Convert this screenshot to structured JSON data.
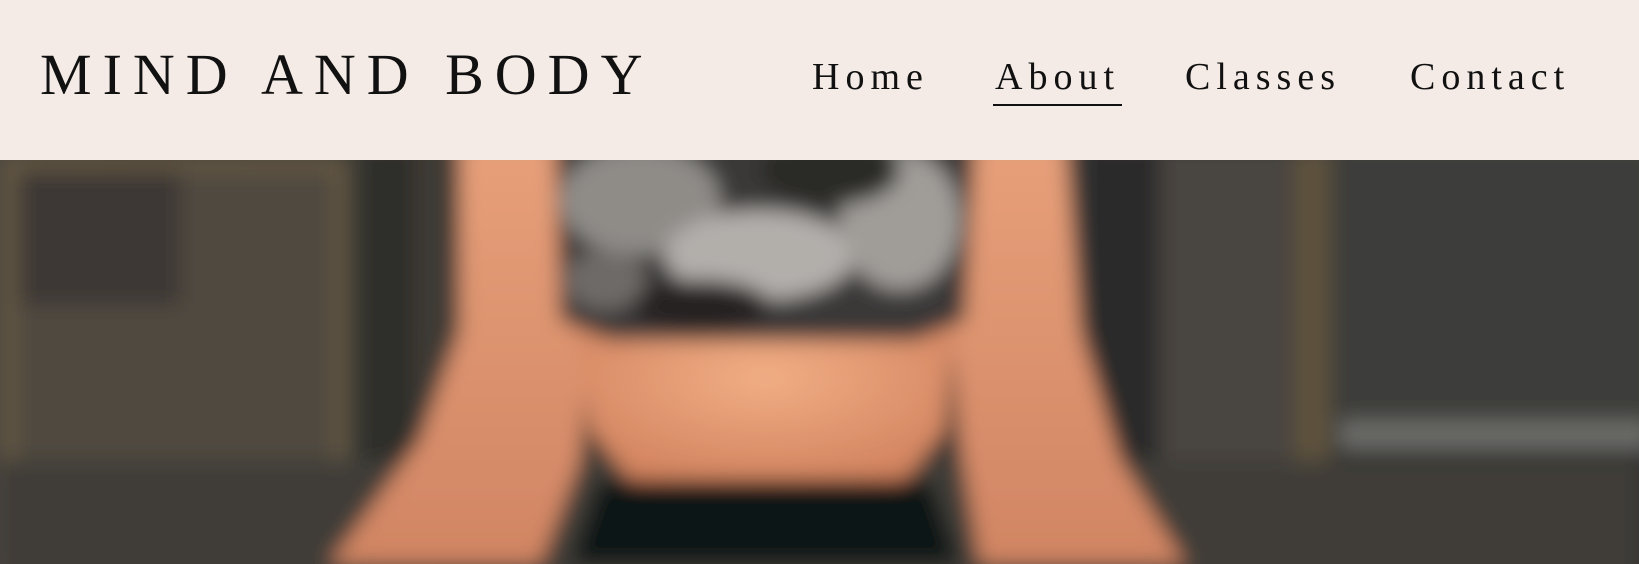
{
  "header": {
    "site_title": "MIND AND BODY"
  },
  "nav": {
    "items": [
      {
        "label": "Home",
        "active": false
      },
      {
        "label": "About",
        "active": true
      },
      {
        "label": "Classes",
        "active": false
      },
      {
        "label": "Contact",
        "active": false
      }
    ]
  },
  "hero": {
    "image_subject": "blurred-photo-of-person-in-patterned-sports-top",
    "colors": {
      "background_wall": "#4a4540",
      "skin": "#d9906c",
      "top_pattern_dark": "#2d2b2a",
      "top_pattern_light": "#9b9894",
      "shorts": "#0f1213"
    }
  },
  "theme": {
    "header_bg": "#f4ebe6",
    "text_color": "#111111"
  }
}
